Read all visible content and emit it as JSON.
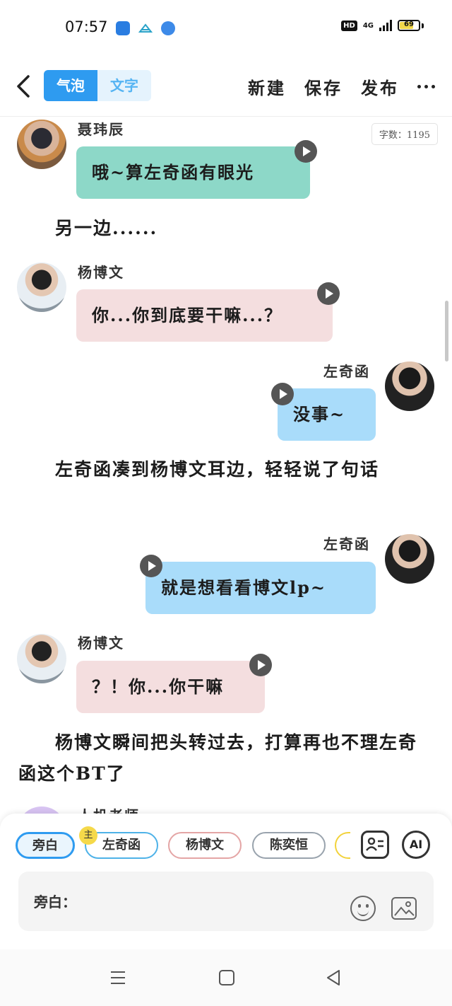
{
  "status_bar": {
    "time": "07:57",
    "hd": "HD",
    "network": "4G",
    "battery": "69"
  },
  "header": {
    "mode_tabs": [
      {
        "label": "气泡",
        "active": true
      },
      {
        "label": "文字",
        "active": false
      }
    ],
    "actions": {
      "new": "新建",
      "save": "保存",
      "publish": "发布"
    }
  },
  "content": {
    "word_count": "字数：1195",
    "messages": [
      {
        "speaker": "聂玮辰",
        "text": "哦~算左奇函有眼光"
      },
      {
        "speaker": "杨博文",
        "text": "你...你到底要干嘛...？"
      },
      {
        "speaker": "左奇函",
        "text": "没事~"
      },
      {
        "speaker": "左奇函",
        "text": "就是想看看博文lp~"
      },
      {
        "speaker": "杨博文",
        "text": "？！你...你干嘛"
      }
    ],
    "narrations": [
      "另一边......",
      "左奇函凑到杨博文耳边，轻轻说了句话",
      "杨博文瞬间把头转过去，打算再也不理左奇函这个BT了"
    ],
    "partial_speaker": "人机老师"
  },
  "bottom_panel": {
    "roles": [
      "旁白",
      "左奇函",
      "杨博文",
      "陈奕恒"
    ],
    "main_badge": "主",
    "ai_label": "AI",
    "input_label": "旁白："
  },
  "colors": {
    "accent": "#2e9bf0",
    "bubble_teal": "#8dd8c8",
    "bubble_pink": "#f4dedf",
    "bubble_blue": "#a9dcfa"
  }
}
